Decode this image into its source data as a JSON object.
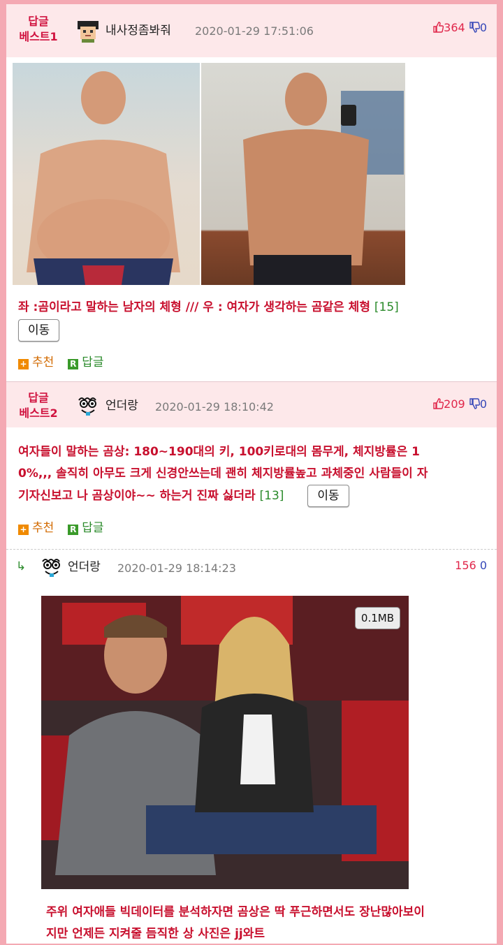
{
  "comments": [
    {
      "badge_line1": "답글",
      "badge_line2": "베스트1",
      "nickname": "내사정좀봐줘",
      "date": "2020-01-29 17:51:06",
      "upvotes": "364",
      "downvotes": "0",
      "text": "좌 :곰이라고 말하는 남자의 체형 /// 우 : 여자가 생각하는 곰같은 체형",
      "reply_count": "[15]",
      "move_label": "이동",
      "recommend_label": "추천",
      "reply_label": "답글"
    },
    {
      "badge_line1": "답글",
      "badge_line2": "베스트2",
      "nickname": "언더랑",
      "date": "2020-01-29 18:10:42",
      "upvotes": "209",
      "downvotes": "0",
      "text_line1": "여자들이 말하는 곰상: 180~190대의 키, 100키로대의 몸무게, 체지방률은 1",
      "text_line2": "0%,,, 솔직히 아무도 크게 신경안쓰는데 괜히 체지방률높고 과체중인 사람들이 자",
      "text_line3": "기자신보고 나 곰상이야~~ 하는거 진짜 싫더라",
      "reply_count": "[13]",
      "move_label": "이동",
      "recommend_label": "추천",
      "reply_label": "답글"
    },
    {
      "reply_arrow": "↳",
      "nickname": "언더랑",
      "date": "2020-01-29 18:14:23",
      "upvotes": "156",
      "downvotes": "0",
      "image_size": "0.1MB",
      "text_line1": "주위 여자애들 빅데이터를 분석하자면 곰상은 딱 푸근하면서도 장난많아보이",
      "text_line2": "지만 언제든 지켜줄 듬직한 상 사진은 jj와트"
    }
  ],
  "colors": {
    "accent": "#d0123f",
    "comment_text": "#c8102e",
    "count_green": "#2a8a2a",
    "header_bg": "#fde8ea",
    "border_pink": "#f4a9b3",
    "up_red": "#e0264a",
    "down_blue": "#3547b8"
  }
}
